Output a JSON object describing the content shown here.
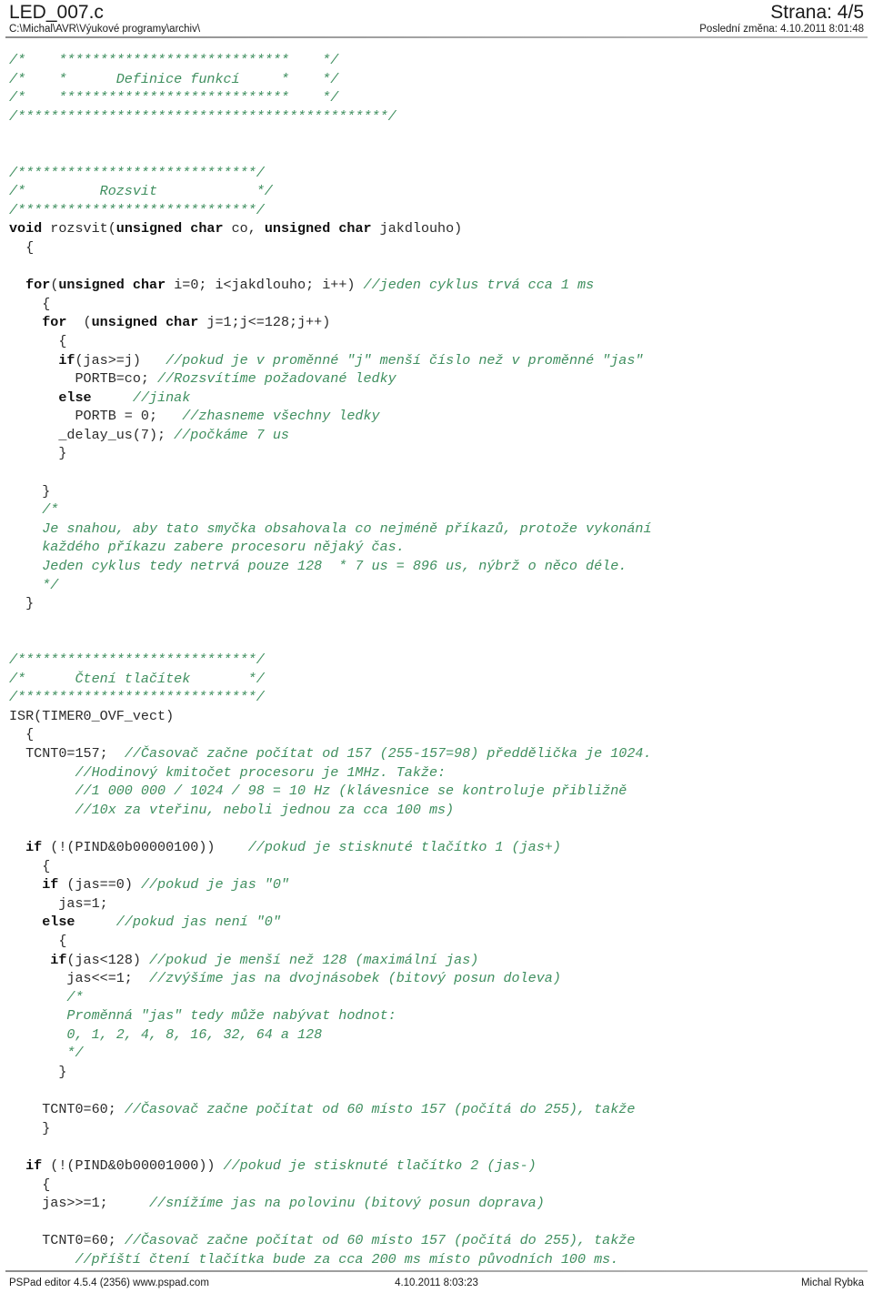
{
  "header": {
    "file_title": "LED_007.c",
    "file_path": "C:\\Michal\\AVR\\Výukové programy\\archiv\\",
    "page_label": "Strana: 4/5",
    "last_change": "Poslední změna: 4.10.2011 8:01:48"
  },
  "footer": {
    "editor": "PSPad editor 4.5.4 (2356)  www.pspad.com",
    "printed": "4.10.2011 8:03:23",
    "author": "Michal Rybka"
  },
  "colors": {
    "comment": "#3f8f5f",
    "keyword": "#111111",
    "plain": "#2b2b2b",
    "background": "#ffffff",
    "rule": "#8d8d8d"
  },
  "code": {
    "language": "c",
    "lines": [
      {
        "segments": [
          {
            "t": "/*    ****************************    */",
            "c": "cmt"
          }
        ]
      },
      {
        "segments": [
          {
            "t": "/*    *      Definice funkcí     *    */",
            "c": "cmt"
          }
        ]
      },
      {
        "segments": [
          {
            "t": "/*    ****************************    */",
            "c": "cmt"
          }
        ]
      },
      {
        "segments": [
          {
            "t": "/*********************************************/",
            "c": "cmt"
          }
        ]
      },
      {
        "segments": [
          {
            "t": "",
            "c": "pl"
          }
        ]
      },
      {
        "segments": [
          {
            "t": "",
            "c": "pl"
          }
        ]
      },
      {
        "segments": [
          {
            "t": "/*****************************/",
            "c": "cmt"
          }
        ]
      },
      {
        "segments": [
          {
            "t": "/*         Rozsvit            */",
            "c": "cmt"
          }
        ]
      },
      {
        "segments": [
          {
            "t": "/*****************************/",
            "c": "cmt"
          }
        ]
      },
      {
        "segments": [
          {
            "t": "void",
            "c": "kw"
          },
          {
            "t": " rozsvit(",
            "c": "pl"
          },
          {
            "t": "unsigned char",
            "c": "kw"
          },
          {
            "t": " co, ",
            "c": "pl"
          },
          {
            "t": "unsigned char",
            "c": "kw"
          },
          {
            "t": " jakdlouho)",
            "c": "pl"
          }
        ]
      },
      {
        "segments": [
          {
            "t": "  {",
            "c": "pl"
          }
        ]
      },
      {
        "segments": [
          {
            "t": "",
            "c": "pl"
          }
        ]
      },
      {
        "segments": [
          {
            "t": "  ",
            "c": "pl"
          },
          {
            "t": "for",
            "c": "kw"
          },
          {
            "t": "(",
            "c": "pl"
          },
          {
            "t": "unsigned char",
            "c": "kw"
          },
          {
            "t": " i=0; i<jakdlouho; i++) ",
            "c": "pl"
          },
          {
            "t": "//jeden cyklus trvá cca 1 ms",
            "c": "cmt"
          }
        ]
      },
      {
        "segments": [
          {
            "t": "    {",
            "c": "pl"
          }
        ]
      },
      {
        "segments": [
          {
            "t": "    ",
            "c": "pl"
          },
          {
            "t": "for",
            "c": "kw"
          },
          {
            "t": "  (",
            "c": "pl"
          },
          {
            "t": "unsigned char",
            "c": "kw"
          },
          {
            "t": " j=1;j<=128;j++)",
            "c": "pl"
          }
        ]
      },
      {
        "segments": [
          {
            "t": "      {",
            "c": "pl"
          }
        ]
      },
      {
        "segments": [
          {
            "t": "      ",
            "c": "pl"
          },
          {
            "t": "if",
            "c": "kw"
          },
          {
            "t": "(jas>=j)   ",
            "c": "pl"
          },
          {
            "t": "//pokud je v proměnné \"j\" menší číslo než v proměnné \"jas\"",
            "c": "cmt"
          }
        ]
      },
      {
        "segments": [
          {
            "t": "        PORTB=co; ",
            "c": "pl"
          },
          {
            "t": "//Rozsvítíme požadované ledky",
            "c": "cmt"
          }
        ]
      },
      {
        "segments": [
          {
            "t": "      ",
            "c": "pl"
          },
          {
            "t": "else",
            "c": "kw"
          },
          {
            "t": "     ",
            "c": "pl"
          },
          {
            "t": "//jinak",
            "c": "cmt"
          }
        ]
      },
      {
        "segments": [
          {
            "t": "        PORTB = 0;   ",
            "c": "pl"
          },
          {
            "t": "//zhasneme všechny ledky",
            "c": "cmt"
          }
        ]
      },
      {
        "segments": [
          {
            "t": "      _delay_us(7); ",
            "c": "pl"
          },
          {
            "t": "//počkáme 7 us",
            "c": "cmt"
          }
        ]
      },
      {
        "segments": [
          {
            "t": "      }",
            "c": "pl"
          }
        ]
      },
      {
        "segments": [
          {
            "t": "",
            "c": "pl"
          }
        ]
      },
      {
        "segments": [
          {
            "t": "    }",
            "c": "pl"
          }
        ]
      },
      {
        "segments": [
          {
            "t": "    /*",
            "c": "cmt"
          }
        ]
      },
      {
        "segments": [
          {
            "t": "    Je snahou, aby tato smyčka obsahovala co nejméně příkazů, protože vykonání",
            "c": "cmt"
          }
        ]
      },
      {
        "segments": [
          {
            "t": "    každého příkazu zabere procesoru nějaký čas.",
            "c": "cmt"
          }
        ]
      },
      {
        "segments": [
          {
            "t": "    Jeden cyklus tedy netrvá pouze 128  * 7 us = 896 us, nýbrž o něco déle.",
            "c": "cmt"
          }
        ]
      },
      {
        "segments": [
          {
            "t": "    */",
            "c": "cmt"
          }
        ]
      },
      {
        "segments": [
          {
            "t": "  }",
            "c": "pl"
          }
        ]
      },
      {
        "segments": [
          {
            "t": "",
            "c": "pl"
          }
        ]
      },
      {
        "segments": [
          {
            "t": "",
            "c": "pl"
          }
        ]
      },
      {
        "segments": [
          {
            "t": "/*****************************/",
            "c": "cmt"
          }
        ]
      },
      {
        "segments": [
          {
            "t": "/*      Čtení tlačítek       */",
            "c": "cmt"
          }
        ]
      },
      {
        "segments": [
          {
            "t": "/*****************************/",
            "c": "cmt"
          }
        ]
      },
      {
        "segments": [
          {
            "t": "ISR(TIMER0_OVF_vect)",
            "c": "pl"
          }
        ]
      },
      {
        "segments": [
          {
            "t": "  {",
            "c": "pl"
          }
        ]
      },
      {
        "segments": [
          {
            "t": "  TCNT0=157;  ",
            "c": "pl"
          },
          {
            "t": "//Časovač začne počítat od 157 (255-157=98) předdělička je 1024.",
            "c": "cmt"
          }
        ]
      },
      {
        "segments": [
          {
            "t": "        //Hodinový kmitočet procesoru je 1MHz. Takže:",
            "c": "cmt"
          }
        ]
      },
      {
        "segments": [
          {
            "t": "        //1 000 000 / 1024 / 98 = 10 Hz (klávesnice se kontroluje přibližně",
            "c": "cmt"
          }
        ]
      },
      {
        "segments": [
          {
            "t": "        //10x za vteřinu, neboli jednou za cca 100 ms)",
            "c": "cmt"
          }
        ]
      },
      {
        "segments": [
          {
            "t": "",
            "c": "pl"
          }
        ]
      },
      {
        "segments": [
          {
            "t": "  ",
            "c": "pl"
          },
          {
            "t": "if",
            "c": "kw"
          },
          {
            "t": " (!(PIND&0b00000100))    ",
            "c": "pl"
          },
          {
            "t": "//pokud je stisknuté tlačítko 1 (jas+)",
            "c": "cmt"
          }
        ]
      },
      {
        "segments": [
          {
            "t": "    {",
            "c": "pl"
          }
        ]
      },
      {
        "segments": [
          {
            "t": "    ",
            "c": "pl"
          },
          {
            "t": "if",
            "c": "kw"
          },
          {
            "t": " (jas==0) ",
            "c": "pl"
          },
          {
            "t": "//pokud je jas \"0\"",
            "c": "cmt"
          }
        ]
      },
      {
        "segments": [
          {
            "t": "      jas=1;",
            "c": "pl"
          }
        ]
      },
      {
        "segments": [
          {
            "t": "    ",
            "c": "pl"
          },
          {
            "t": "else",
            "c": "kw"
          },
          {
            "t": "     ",
            "c": "pl"
          },
          {
            "t": "//pokud jas není \"0\"",
            "c": "cmt"
          }
        ]
      },
      {
        "segments": [
          {
            "t": "      {",
            "c": "pl"
          }
        ]
      },
      {
        "segments": [
          {
            "t": "     ",
            "c": "pl"
          },
          {
            "t": "if",
            "c": "kw"
          },
          {
            "t": "(jas<128) ",
            "c": "pl"
          },
          {
            "t": "//pokud je menší než 128 (maximální jas)",
            "c": "cmt"
          }
        ]
      },
      {
        "segments": [
          {
            "t": "       jas<<=1;  ",
            "c": "pl"
          },
          {
            "t": "//zvýšíme jas na dvojnásobek (bitový posun doleva)",
            "c": "cmt"
          }
        ]
      },
      {
        "segments": [
          {
            "t": "       /*",
            "c": "cmt"
          }
        ]
      },
      {
        "segments": [
          {
            "t": "       Proměnná \"jas\" tedy může nabývat hodnot:",
            "c": "cmt"
          }
        ]
      },
      {
        "segments": [
          {
            "t": "       0, 1, 2, 4, 8, 16, 32, 64 a 128",
            "c": "cmt"
          }
        ]
      },
      {
        "segments": [
          {
            "t": "       */",
            "c": "cmt"
          }
        ]
      },
      {
        "segments": [
          {
            "t": "      }",
            "c": "pl"
          }
        ]
      },
      {
        "segments": [
          {
            "t": "",
            "c": "pl"
          }
        ]
      },
      {
        "segments": [
          {
            "t": "    TCNT0=60; ",
            "c": "pl"
          },
          {
            "t": "//Časovač začne počítat od 60 místo 157 (počítá do 255), takže",
            "c": "cmt"
          }
        ]
      },
      {
        "segments": [
          {
            "t": "    }",
            "c": "pl"
          }
        ]
      },
      {
        "segments": [
          {
            "t": "",
            "c": "pl"
          }
        ]
      },
      {
        "segments": [
          {
            "t": "  ",
            "c": "pl"
          },
          {
            "t": "if",
            "c": "kw"
          },
          {
            "t": " (!(PIND&0b00001000)) ",
            "c": "pl"
          },
          {
            "t": "//pokud je stisknuté tlačítko 2 (jas-)",
            "c": "cmt"
          }
        ]
      },
      {
        "segments": [
          {
            "t": "    {",
            "c": "pl"
          }
        ]
      },
      {
        "segments": [
          {
            "t": "    jas>>=1;     ",
            "c": "pl"
          },
          {
            "t": "//snížíme jas na polovinu (bitový posun doprava)",
            "c": "cmt"
          }
        ]
      },
      {
        "segments": [
          {
            "t": "",
            "c": "pl"
          }
        ]
      },
      {
        "segments": [
          {
            "t": "    TCNT0=60; ",
            "c": "pl"
          },
          {
            "t": "//Časovač začne počítat od 60 místo 157 (počítá do 255), takže",
            "c": "cmt"
          }
        ]
      },
      {
        "segments": [
          {
            "t": "        //příští čtení tlačítka bude za cca 200 ms místo původních 100 ms.",
            "c": "cmt"
          }
        ]
      }
    ]
  }
}
